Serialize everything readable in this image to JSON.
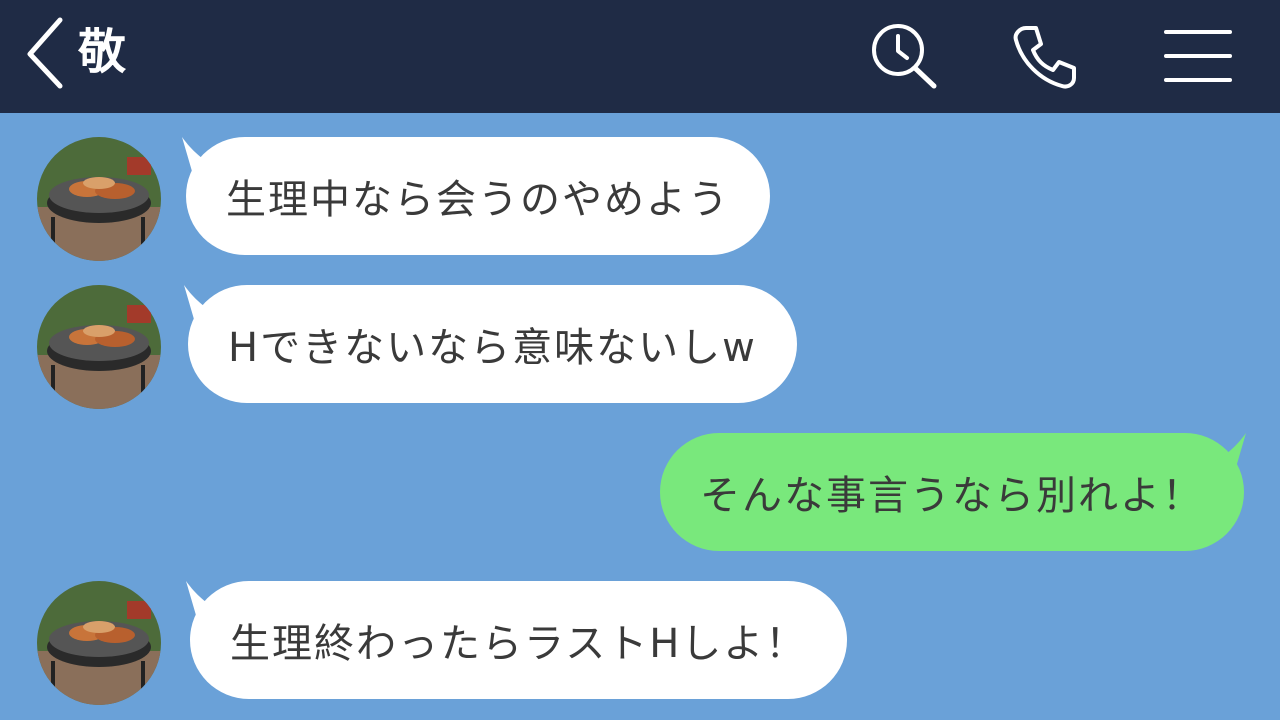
{
  "header": {
    "title": "敬",
    "icons": [
      "back-icon",
      "search-icon",
      "phone-icon",
      "menu-icon"
    ]
  },
  "messages": [
    {
      "sender": "other",
      "text": "生理中なら会うのやめよう"
    },
    {
      "sender": "other",
      "text": "Hできないなら意味ないしw"
    },
    {
      "sender": "me",
      "text": "そんな事言うなら別れよ！"
    },
    {
      "sender": "other",
      "text": "生理終わったらラストHしよ！"
    }
  ],
  "colors": {
    "header_bg": "#1f2b45",
    "chat_bg": "#6aa1d8",
    "incoming_bubble": "#ffffff",
    "outgoing_bubble": "#79e87c",
    "text": "#3a3a3a"
  }
}
